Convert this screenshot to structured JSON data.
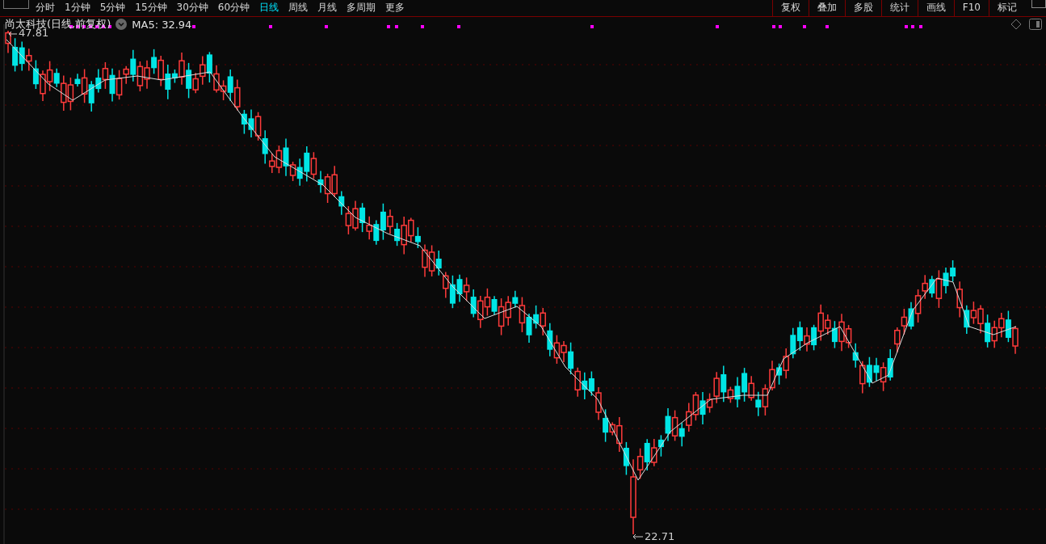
{
  "toolbar": {
    "periods": [
      {
        "label": "分时",
        "selected": false
      },
      {
        "label": "1分钟",
        "selected": false
      },
      {
        "label": "5分钟",
        "selected": false
      },
      {
        "label": "15分钟",
        "selected": false
      },
      {
        "label": "30分钟",
        "selected": false
      },
      {
        "label": "60分钟",
        "selected": false
      },
      {
        "label": "日线",
        "selected": true
      },
      {
        "label": "周线",
        "selected": false
      },
      {
        "label": "月线",
        "selected": false
      },
      {
        "label": "多周期",
        "selected": false
      },
      {
        "label": "更多",
        "selected": false
      }
    ],
    "tools": [
      "复权",
      "叠加",
      "多股",
      "统计",
      "画线",
      "F10",
      "标记"
    ]
  },
  "chart": {
    "title": "尚太科技(日线,前复权)",
    "indicator": "MA5: 32.94",
    "high_label": "47.81",
    "low_label": "22.71"
  }
}
